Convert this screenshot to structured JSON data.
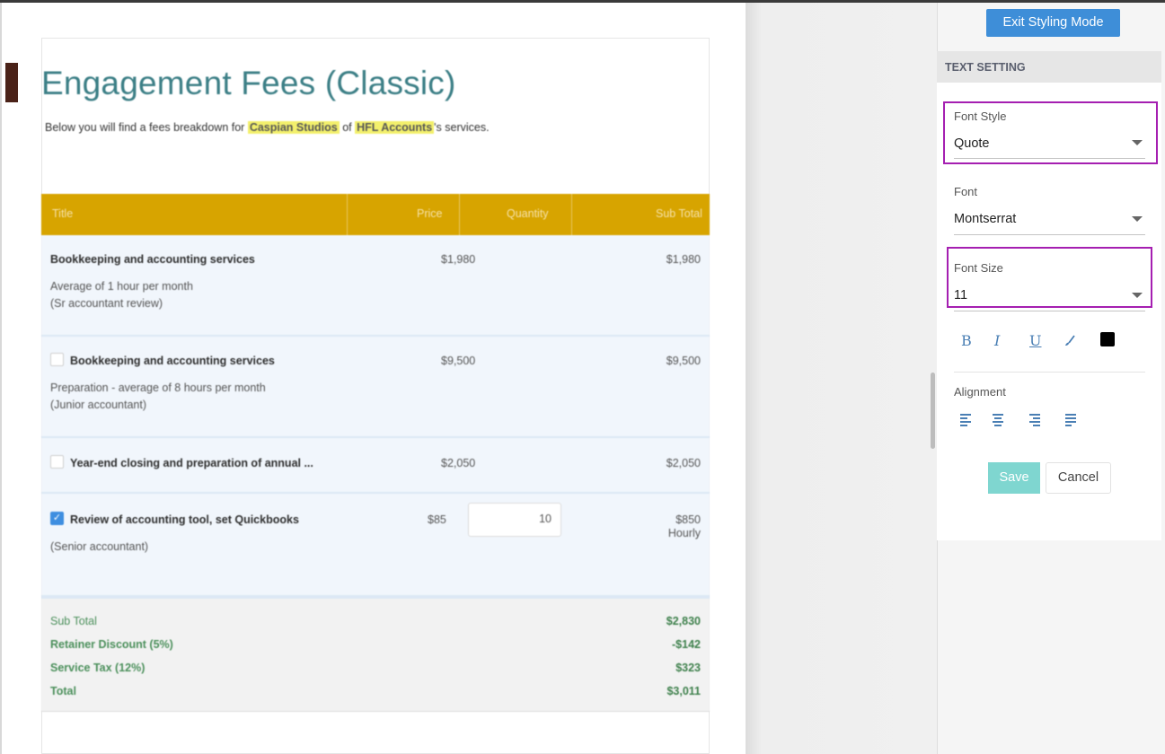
{
  "document": {
    "title": "Engagement Fees (Classic)",
    "intro": {
      "before": "Below you will find a fees breakdown for ",
      "client": "Caspian Studios",
      "middle": " of ",
      "company": "HFL Accounts",
      "after": "'s services."
    },
    "table": {
      "headers": {
        "title": "Title",
        "price": "Price",
        "quantity": "Quantity",
        "subtotal": "Sub Total"
      },
      "header_color": "#d7a400",
      "rows": [
        {
          "name": "Bookkeeping and accounting services",
          "desc1": "Average of 1 hour per month",
          "desc2": "(Sr accountant review)",
          "price": "$1,980",
          "subtotal": "$1,980",
          "checkbox": "none"
        },
        {
          "name": "Bookkeeping and accounting services",
          "desc1": "Preparation - average of 8 hours per month",
          "desc2": "(Junior accountant)",
          "price": "$9,500",
          "subtotal": "$9,500",
          "checkbox": "unchecked"
        },
        {
          "name": "Year-end closing and preparation of annual ...",
          "price": "$2,050",
          "subtotal": "$2,050",
          "checkbox": "unchecked"
        },
        {
          "name": "Review of accounting tool, set Quickbooks",
          "desc1": "(Senior accountant)",
          "price": "$85",
          "quantity": "10",
          "subtotal": "$850",
          "unit": "Hourly",
          "checkbox": "checked"
        }
      ],
      "totals": [
        {
          "label": "Sub Total",
          "value": "$2,830"
        },
        {
          "label": "Retainer Discount (5%)",
          "value": "-$142"
        },
        {
          "label": "Service Tax (12%)",
          "value": "$323"
        },
        {
          "label": "Total",
          "value": "$3,011"
        }
      ]
    }
  },
  "panel": {
    "exit_label": "Exit Styling Mode",
    "section_title": "TEXT SETTING",
    "font_style": {
      "label": "Font Style",
      "value": "Quote"
    },
    "font": {
      "label": "Font",
      "value": "Montserrat"
    },
    "font_size": {
      "label": "Font Size",
      "value": "11"
    },
    "format": {
      "bold": "B",
      "italic": "I",
      "underline": "U",
      "color_icon": "brush-icon",
      "color": "#000000"
    },
    "alignment_label": "Alignment",
    "alignment_icons": [
      "align-left-icon",
      "align-center-icon",
      "align-right-icon",
      "align-justify-icon"
    ],
    "save_label": "Save",
    "cancel_label": "Cancel",
    "highlight_color": "#a51fb1",
    "accent": "#3e8ed8"
  }
}
